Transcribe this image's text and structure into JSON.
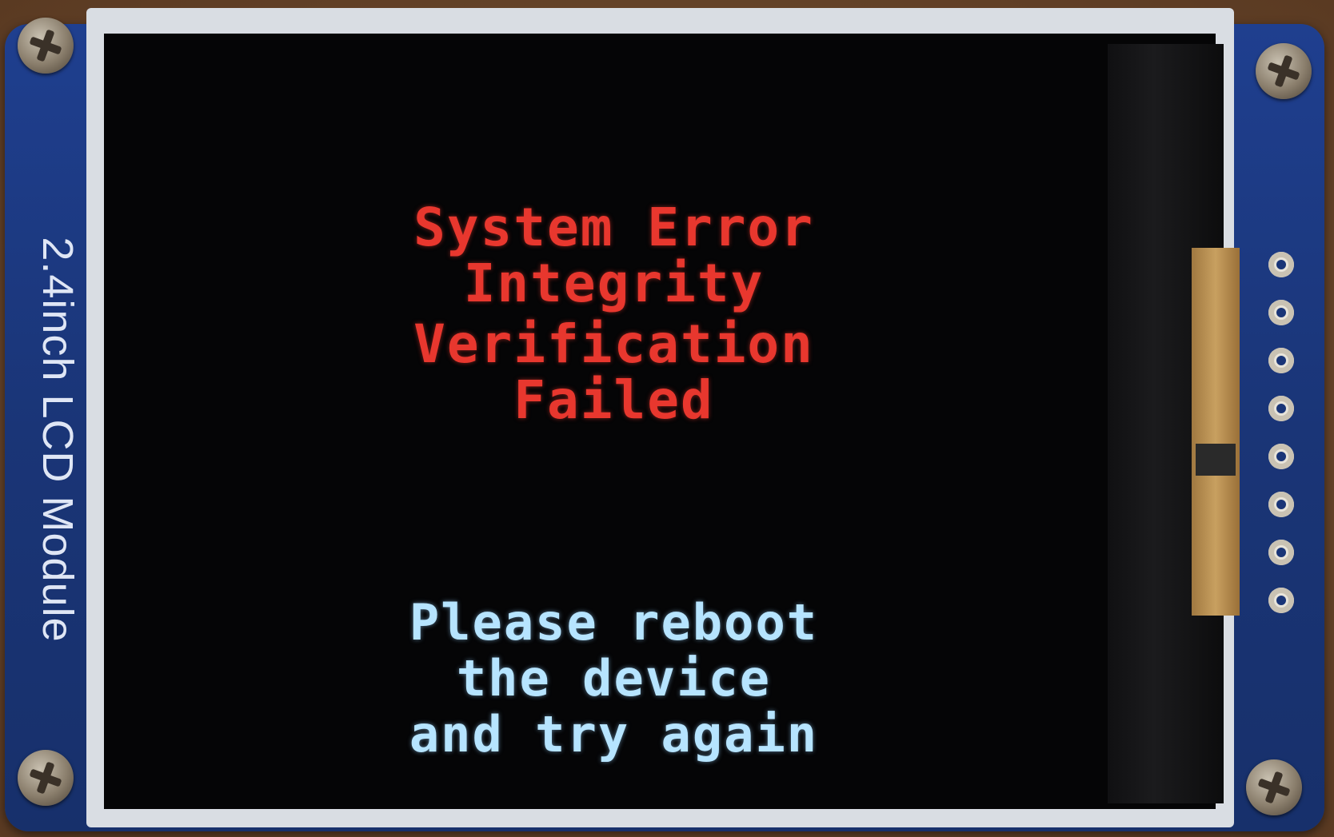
{
  "module": {
    "label": "2.4inch LCD Module"
  },
  "display": {
    "error_lines": [
      "System Error",
      "Integrity",
      "Verification",
      "Failed"
    ],
    "info_lines": [
      "Please reboot",
      "the device",
      "and try again"
    ]
  },
  "colors": {
    "error_text": "#e8372e",
    "info_text": "#b6e4ff",
    "pcb": "#1a3577",
    "screen": "#050506"
  }
}
